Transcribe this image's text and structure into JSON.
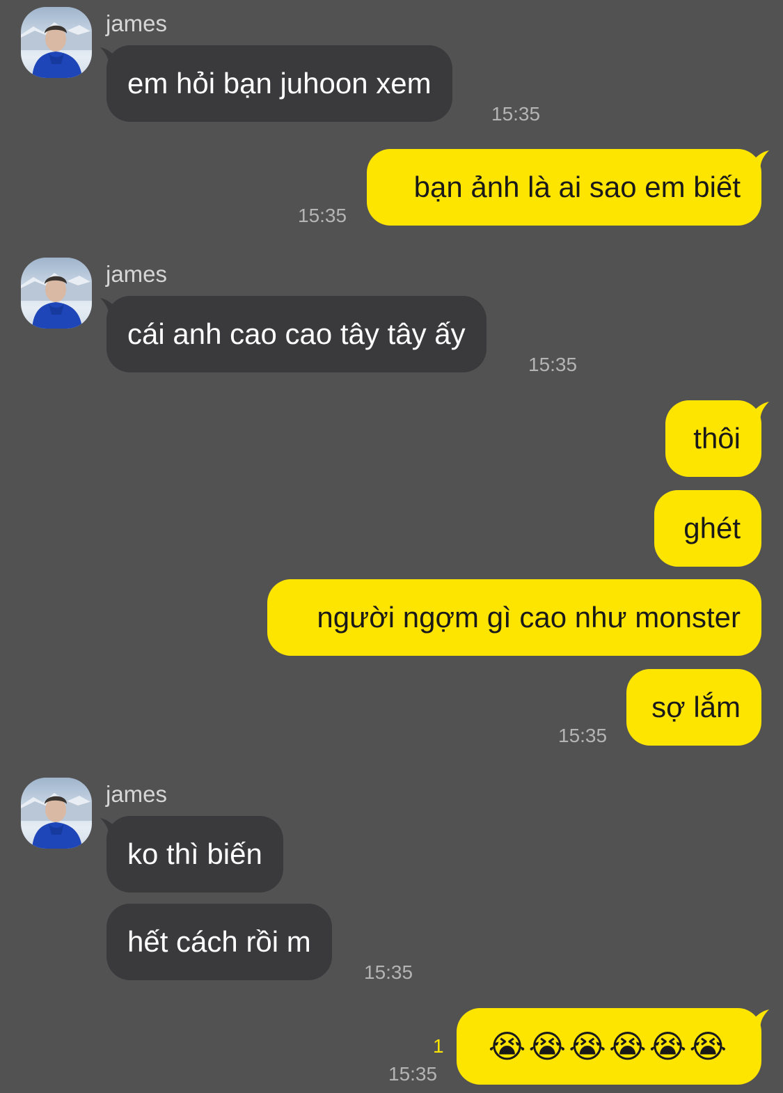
{
  "colors": {
    "background": "#535253",
    "incoming_bubble": "#3a393b",
    "outgoing_bubble": "#fee500",
    "timestamp": "#b4b4b4",
    "unread_count": "#fee500"
  },
  "messages": [
    {
      "sender": "james",
      "text": "em hỏi bạn juhoon xem",
      "time": "15:35"
    },
    {
      "sender": "me",
      "text": "bạn ảnh là ai sao em biết",
      "time": "15:35"
    },
    {
      "sender": "james",
      "text": "cái anh cao cao tây tây ấy",
      "time": "15:35"
    },
    {
      "sender": "me",
      "text": "thôi"
    },
    {
      "sender": "me",
      "text": "ghét"
    },
    {
      "sender": "me",
      "text": "người ngợm gì cao như monster"
    },
    {
      "sender": "me",
      "text": "sợ lắm",
      "time": "15:35"
    },
    {
      "sender": "james",
      "text": "ko thì biến"
    },
    {
      "sender": "james",
      "text": "hết cách rồi m",
      "time": "15:35"
    },
    {
      "sender": "me",
      "text": "😭😭😭😭😭😭",
      "time": "15:35",
      "unread": "1"
    }
  ],
  "avatar_icon": "user-photo-avatar"
}
